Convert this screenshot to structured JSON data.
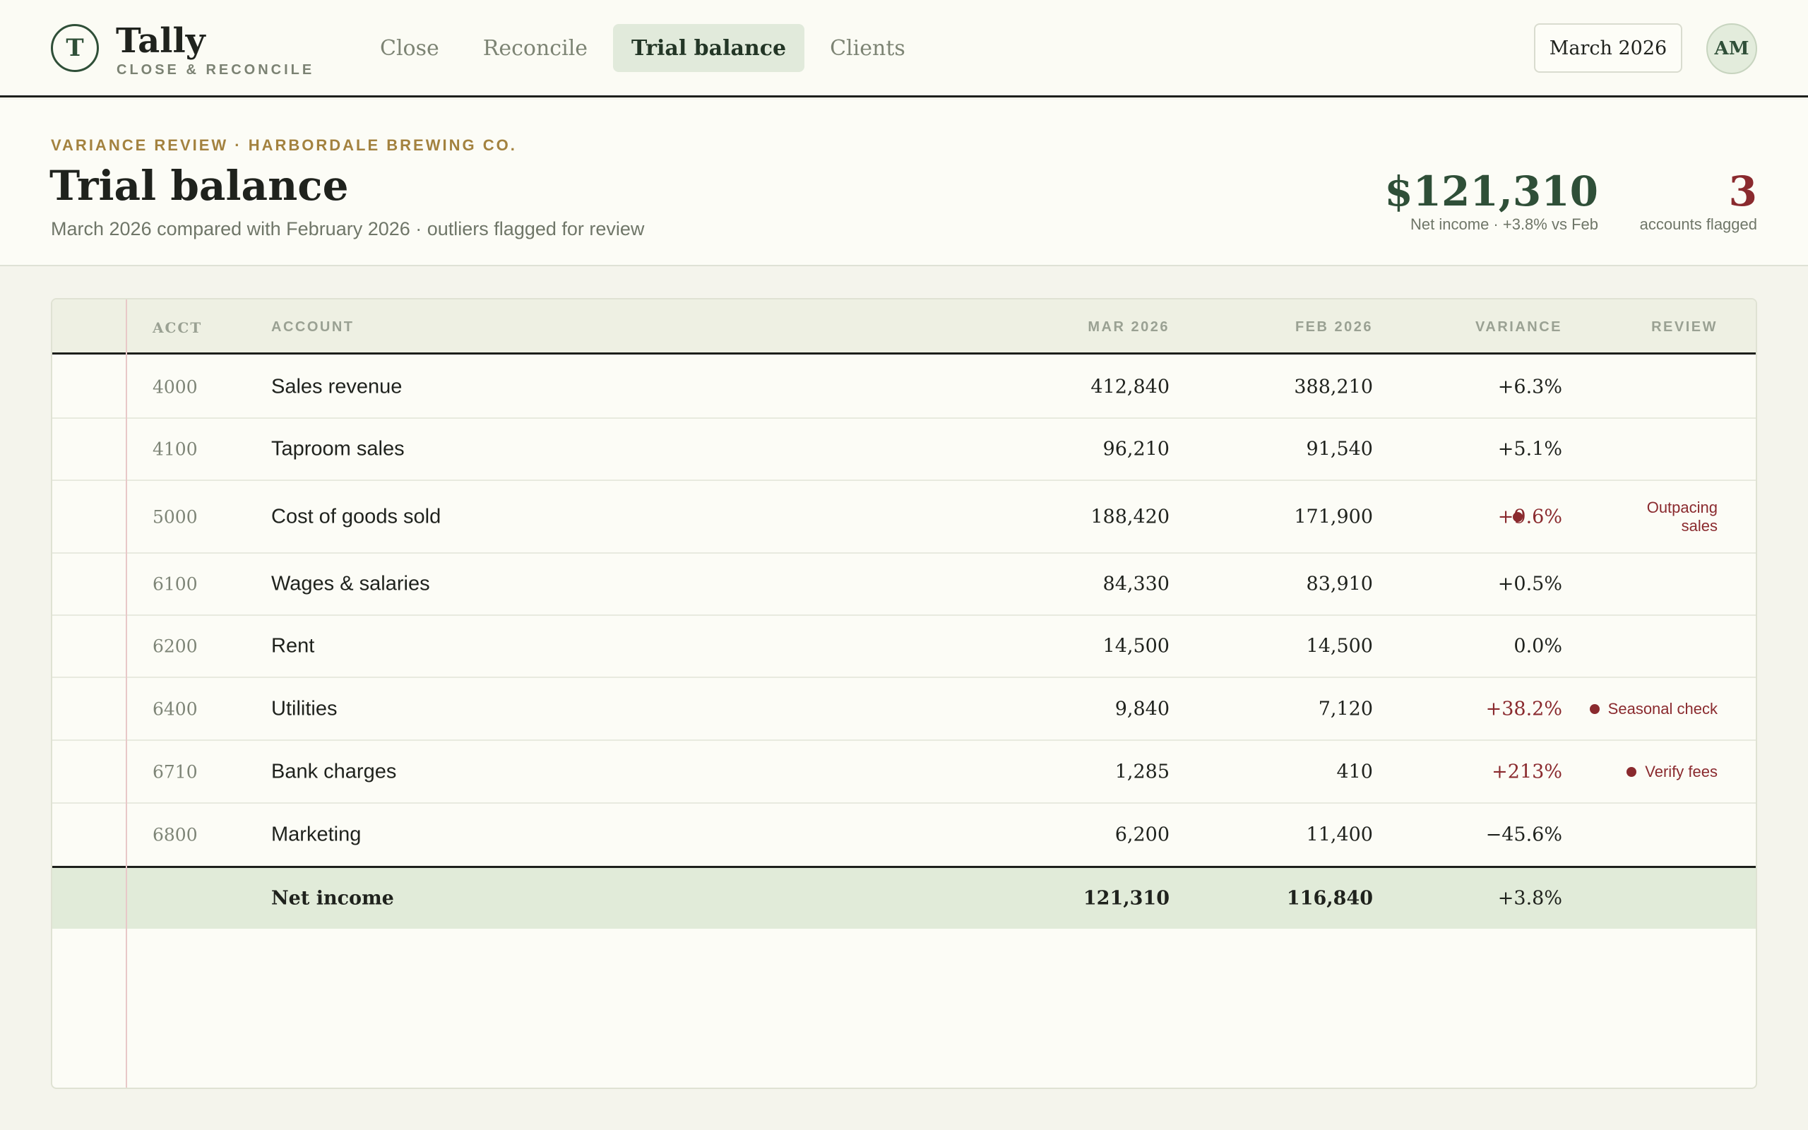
{
  "brand": {
    "logo_letter": "T",
    "name": "Tally",
    "tagline": "CLOSE & RECONCILE"
  },
  "nav": {
    "tabs": [
      {
        "label": "Close"
      },
      {
        "label": "Reconcile"
      },
      {
        "label": "Trial balance",
        "active": true
      },
      {
        "label": "Clients"
      }
    ]
  },
  "period": {
    "label": "March 2026"
  },
  "user": {
    "initials": "AM"
  },
  "header": {
    "eyebrow": "VARIANCE REVIEW · HARBORDALE BREWING CO.",
    "title": "Trial balance",
    "subtitle": "March 2026 compared with February 2026 · outliers flagged for review"
  },
  "kpis": {
    "net_income": {
      "value": "$121,310",
      "label": "Net income · +3.8% vs Feb"
    },
    "flagged": {
      "value": "3",
      "label": "accounts flagged"
    }
  },
  "table": {
    "columns": {
      "acct": "ACCT",
      "account": "ACCOUNT",
      "mar": "MAR 2026",
      "feb": "FEB 2026",
      "variance": "VARIANCE",
      "review": "REVIEW"
    },
    "rows": [
      {
        "acct": "4000",
        "account": "Sales revenue",
        "mar": "412,840",
        "feb": "388,210",
        "variance": "+6.3%",
        "flagged": false,
        "review": ""
      },
      {
        "acct": "4100",
        "account": "Taproom sales",
        "mar": "96,210",
        "feb": "91,540",
        "variance": "+5.1%",
        "flagged": false,
        "review": ""
      },
      {
        "acct": "5000",
        "account": "Cost of goods sold",
        "mar": "188,420",
        "feb": "171,900",
        "variance": "+9.6%",
        "flagged": true,
        "review_line1": "Outpacing",
        "review_line2": "sales"
      },
      {
        "acct": "6100",
        "account": "Wages & salaries",
        "mar": "84,330",
        "feb": "83,910",
        "variance": "+0.5%",
        "flagged": false,
        "review": ""
      },
      {
        "acct": "6200",
        "account": "Rent",
        "mar": "14,500",
        "feb": "14,500",
        "variance": "0.0%",
        "flagged": false,
        "review": ""
      },
      {
        "acct": "6400",
        "account": "Utilities",
        "mar": "9,840",
        "feb": "7,120",
        "variance": "+38.2%",
        "flagged": true,
        "review": "Seasonal check"
      },
      {
        "acct": "6710",
        "account": "Bank charges",
        "mar": "1,285",
        "feb": "410",
        "variance": "+213%",
        "flagged": true,
        "review": "Verify fees"
      },
      {
        "acct": "6800",
        "account": "Marketing",
        "mar": "6,200",
        "feb": "11,400",
        "variance": "−45.6%",
        "flagged": false,
        "review": ""
      }
    ],
    "total": {
      "account": "Net income",
      "mar": "121,310",
      "feb": "116,840",
      "variance": "+3.8%"
    }
  },
  "colors": {
    "brand_green": "#2f4f38",
    "flag_red": "#8a2a2e",
    "eyebrow_gold": "#a3823f",
    "active_tab_bg": "#e1eadb"
  }
}
